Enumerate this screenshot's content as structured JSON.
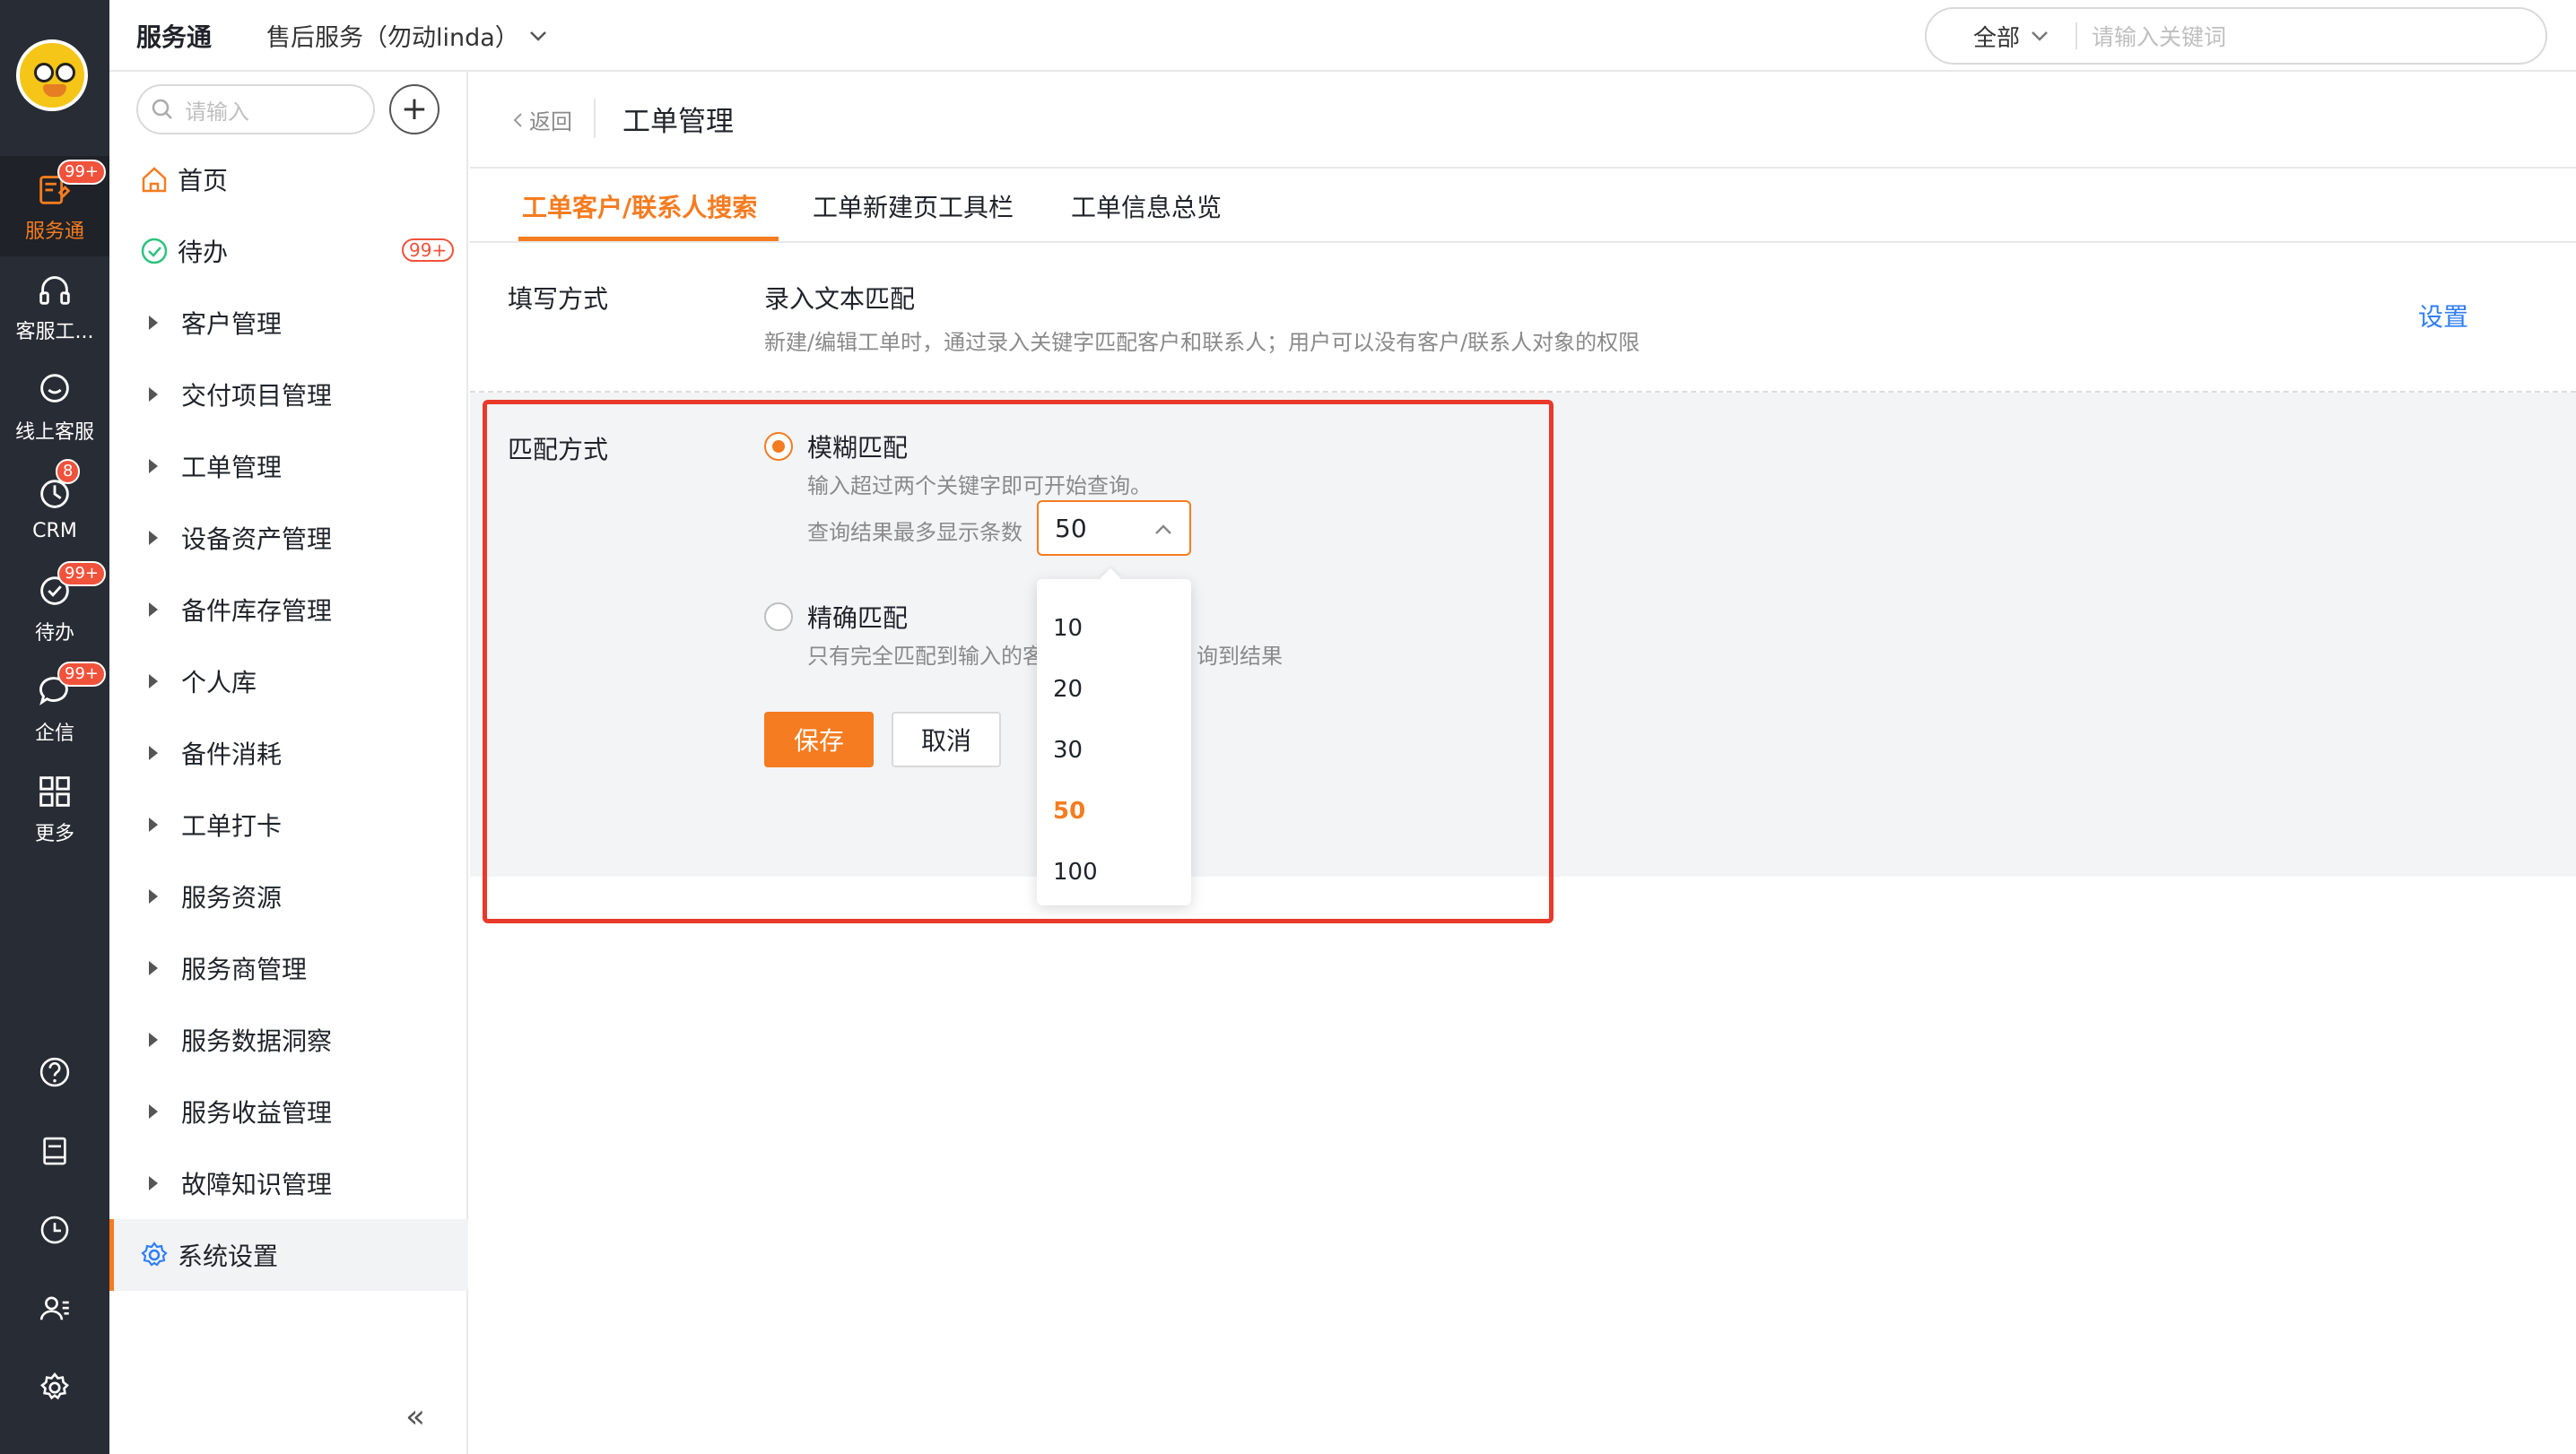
{
  "rail": {
    "items": [
      {
        "label": "服务通",
        "badge": "99+",
        "icon": "service-icon"
      },
      {
        "label": "客服工...",
        "icon": "headset-icon"
      },
      {
        "label": "线上客服",
        "icon": "chat-icon"
      },
      {
        "label": "CRM",
        "badge": "8",
        "icon": "clock-icon"
      },
      {
        "label": "待办",
        "badge": "99+",
        "icon": "check-circle-icon"
      },
      {
        "label": "企信",
        "badge": "99+",
        "icon": "message-icon"
      },
      {
        "label": "更多",
        "icon": "grid-icon"
      }
    ],
    "bottom_icons": [
      "help-icon",
      "book-icon",
      "history-icon",
      "contacts-icon",
      "settings-icon"
    ]
  },
  "topbar": {
    "app_name": "服务通",
    "workspace": "售后服务（勿动linda）",
    "search_scope": "全部",
    "search_placeholder": "请输入关键词"
  },
  "nav": {
    "search_placeholder": "请输入",
    "add_label": "+",
    "items": [
      {
        "label": "首页",
        "icon": "home-icon"
      },
      {
        "label": "待办",
        "icon": "check-icon",
        "badge": "99+"
      },
      {
        "label": "客户管理"
      },
      {
        "label": "交付项目管理"
      },
      {
        "label": "工单管理"
      },
      {
        "label": "设备资产管理"
      },
      {
        "label": "备件库存管理"
      },
      {
        "label": "个人库"
      },
      {
        "label": "备件消耗"
      },
      {
        "label": "工单打卡"
      },
      {
        "label": "服务资源"
      },
      {
        "label": "服务商管理"
      },
      {
        "label": "服务数据洞察"
      },
      {
        "label": "服务收益管理"
      },
      {
        "label": "故障知识管理"
      },
      {
        "label": "系统设置",
        "icon": "gear-icon",
        "selected": true
      }
    ],
    "collapse_label": "«"
  },
  "page": {
    "back_label": "返回",
    "title": "工单管理",
    "tabs": [
      "工单客户/联系人搜索",
      "工单新建页工具栏",
      "工单信息总览"
    ],
    "active_tab": 0
  },
  "fill_mode": {
    "label": "填写方式",
    "value": "录入文本匹配",
    "desc": "新建/编辑工单时，通过录入关键字匹配客户和联系人；用户可以没有客户/联系人对象的权限",
    "settings_link": "设置"
  },
  "match_mode": {
    "label": "匹配方式",
    "fuzzy": {
      "title": "模糊匹配",
      "desc": "输入超过两个关键字即可开始查询。",
      "limit_label": "查询结果最多显示条数",
      "limit_value": "50",
      "checked": true
    },
    "exact": {
      "title": "精确匹配",
      "desc": "只有完全匹配到输入的客",
      "desc_tail": "询到结果",
      "checked": false
    },
    "save_label": "保存",
    "cancel_label": "取消"
  },
  "dropdown": {
    "options": [
      "10",
      "20",
      "30",
      "50",
      "100"
    ],
    "selected": "50"
  },
  "colors": {
    "accent": "#f57c20",
    "highlight_border": "#e8392b",
    "link": "#2f7ef5",
    "rail_bg": "#282c34"
  }
}
